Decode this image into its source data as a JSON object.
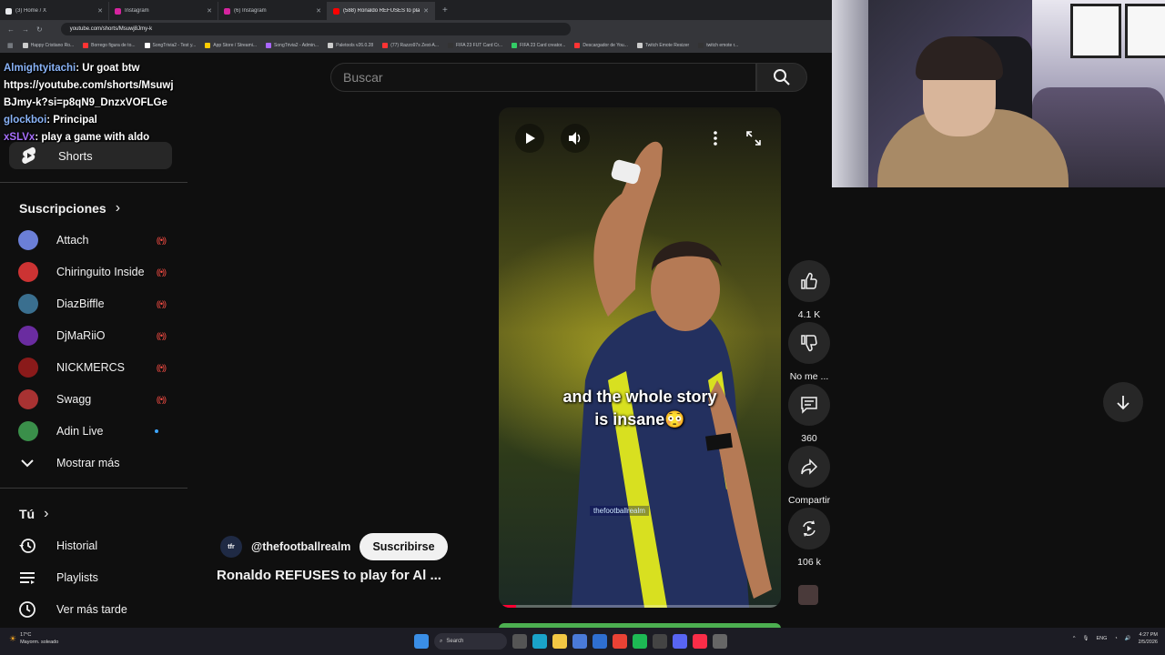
{
  "browser": {
    "tabs": [
      {
        "title": "(3) Home / X",
        "color": "#e8eaed"
      },
      {
        "title": "Instagram",
        "color": "#d6249f"
      },
      {
        "title": "(6) Instagram",
        "color": "#d6249f"
      },
      {
        "title": "(588) Ronaldo REFUSES to play",
        "color": "#ff0000"
      }
    ],
    "url": "youtube.com/shorts/Msuwj8Jmy-k",
    "bookmarks": [
      "Happy Cristiano Ro...",
      "Borrego figura de to...",
      "SongTrivia2 - Test y...",
      "App Store / Streami...",
      "SongTrivia2 - Admin...",
      "Paletools v26.0.28",
      "(77) Razzo97s Zest-A...",
      "FIFA 23 FUT Card Cr...",
      "FIFA 23 Card creator...",
      "Descargador de You...",
      "Twitch Emote Resizer",
      "twitch emote r..."
    ]
  },
  "chat": [
    {
      "user": "Almightyitachi",
      "text": ": Ur goat btw"
    },
    {
      "user": "",
      "text": "https://youtube.com/shorts/Msuwj"
    },
    {
      "user": "",
      "text": "BJmy-k?si=p8qN9_DnzxVOFLGe"
    },
    {
      "user": "glockboi",
      "text": ": Principal"
    },
    {
      "user": "xSLVx",
      "text": ": play a game with aldo"
    }
  ],
  "sidebar": {
    "shorts_label": "Shorts",
    "subscriptions_heading": "Suscripciones",
    "subscriptions": [
      {
        "name": "Attach",
        "status": "live",
        "avatar_color": "#6b7fd7"
      },
      {
        "name": "Chiringuito Inside",
        "status": "live",
        "avatar_color": "#cc3333"
      },
      {
        "name": "DiazBiffle",
        "status": "live",
        "avatar_color": "#3a6f8f"
      },
      {
        "name": "DjMaRiiO",
        "status": "live",
        "avatar_color": "#6a2ca0"
      },
      {
        "name": "NICKMERCS",
        "status": "live",
        "avatar_color": "#8a1a1a"
      },
      {
        "name": "Swagg",
        "status": "live",
        "avatar_color": "#a83232"
      },
      {
        "name": "Adin Live",
        "status": "new",
        "avatar_color": "#3a8f4a"
      }
    ],
    "show_more": "Mostrar más",
    "you_heading": "Tú",
    "you_items": [
      {
        "label": "Historial",
        "icon": "history-icon"
      },
      {
        "label": "Playlists",
        "icon": "playlist-icon"
      },
      {
        "label": "Ver más tarde",
        "icon": "clock-icon"
      }
    ]
  },
  "search": {
    "placeholder": "Buscar"
  },
  "video": {
    "caption_line1": "and the whole story",
    "caption_line2": "is insane😳",
    "watermark": "thefootballrealm",
    "progress": 0.06
  },
  "channel": {
    "avatar_text": "tfr",
    "handle": "@thefootballrealm",
    "subscribe_label": "Suscribirse",
    "title": "Ronaldo REFUSES to play for Al ..."
  },
  "actions": {
    "likes": "4.1 K",
    "dislike_label": "No me ...",
    "comments": "360",
    "share_label": "Compartir",
    "remixes": "106 k"
  },
  "taskbar": {
    "weather_temp": "17°C",
    "weather_desc": "Mayorm. soleado",
    "search_label": "Search",
    "lang": "ENG",
    "time": "4:27 PM",
    "date": "2/5/2026"
  }
}
